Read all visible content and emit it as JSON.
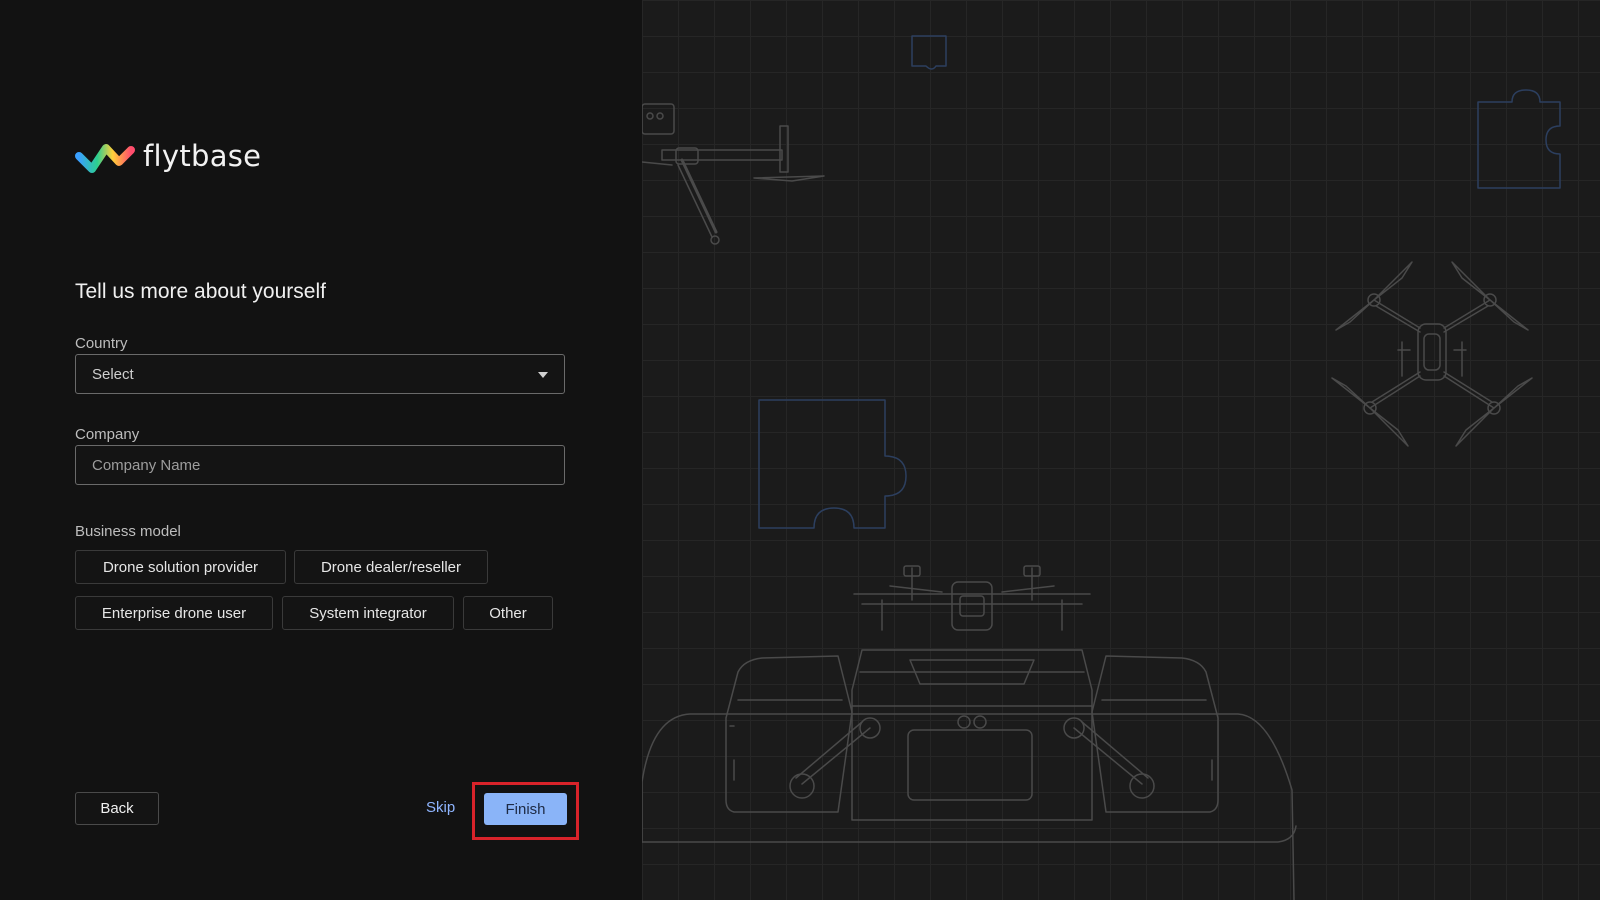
{
  "brand": {
    "name": "flytbase"
  },
  "form": {
    "title": "Tell us more about yourself",
    "country": {
      "label": "Country",
      "value": "Select"
    },
    "company": {
      "label": "Company",
      "placeholder": "Company Name"
    },
    "business_model": {
      "label": "Business model",
      "options": [
        "Drone solution provider",
        "Drone dealer/reseller",
        "Enterprise drone user",
        "System integrator",
        "Other"
      ]
    }
  },
  "actions": {
    "back": "Back",
    "skip": "Skip",
    "finish": "Finish"
  },
  "colors": {
    "background": "#121212",
    "accent": "#8ab4f8",
    "link": "#8fb5ff",
    "highlight": "#d9232a",
    "illustration_line": "#4a4a4a",
    "puzzle_line": "#2c3f5f"
  },
  "icons": [
    "flytbase-logo-icon",
    "dropdown-caret-icon"
  ],
  "illustration": [
    "drone-top-left",
    "puzzle-piece-top",
    "puzzle-piece-top-right",
    "quadcopter-drone",
    "puzzle-piece-center",
    "docking-station-with-drone"
  ]
}
